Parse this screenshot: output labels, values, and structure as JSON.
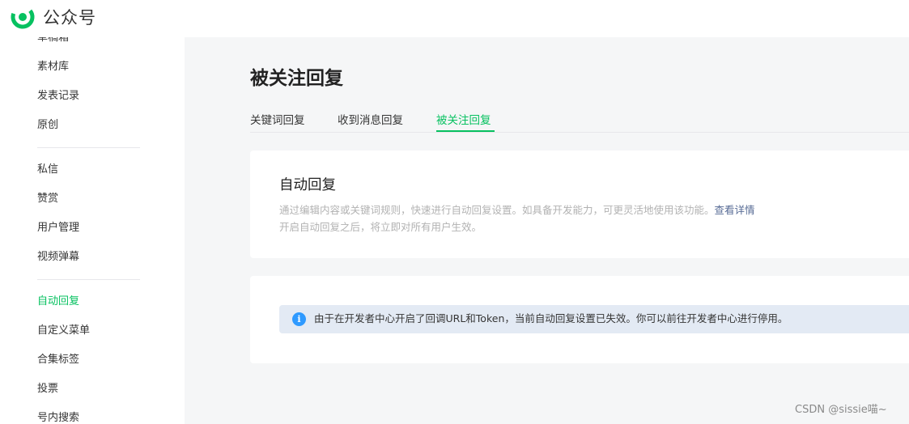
{
  "header": {
    "logo_icon": "wechat-mp-logo-icon",
    "title": "公众号",
    "brand_color": "#07c160"
  },
  "sidebar": {
    "groups": [
      {
        "items": [
          {
            "label": "草稿箱"
          },
          {
            "label": "素材库"
          },
          {
            "label": "发表记录"
          },
          {
            "label": "原创"
          }
        ]
      },
      {
        "items": [
          {
            "label": "私信"
          },
          {
            "label": "赞赏"
          },
          {
            "label": "用户管理"
          },
          {
            "label": "视频弹幕"
          }
        ]
      },
      {
        "items": [
          {
            "label": "自动回复",
            "active": true
          },
          {
            "label": "自定义菜单"
          },
          {
            "label": "合集标签"
          },
          {
            "label": "投票"
          },
          {
            "label": "号内搜索"
          }
        ]
      }
    ]
  },
  "main": {
    "title": "被关注回复",
    "tabs": [
      {
        "label": "关键词回复"
      },
      {
        "label": "收到消息回复"
      },
      {
        "label": "被关注回复",
        "active": true
      }
    ],
    "auto_reply_card": {
      "title": "自动回复",
      "desc_line1": "通过编辑内容或关键词规则，快速进行自动回复设置。如具备开发能力，可更灵活地使用该功能。",
      "detail_link": "查看详情",
      "desc_line2": "开启自动回复之后，将立即对所有用户生效。"
    },
    "notice_card": {
      "icon": "info-icon",
      "text": "由于在开发者中心开启了回调URL和Token，当前自动回复设置已失效。你可以前往开发者中心进行停用。",
      "accent_color": "#2f9aff"
    }
  },
  "watermark": "CSDN @sissie喵~"
}
